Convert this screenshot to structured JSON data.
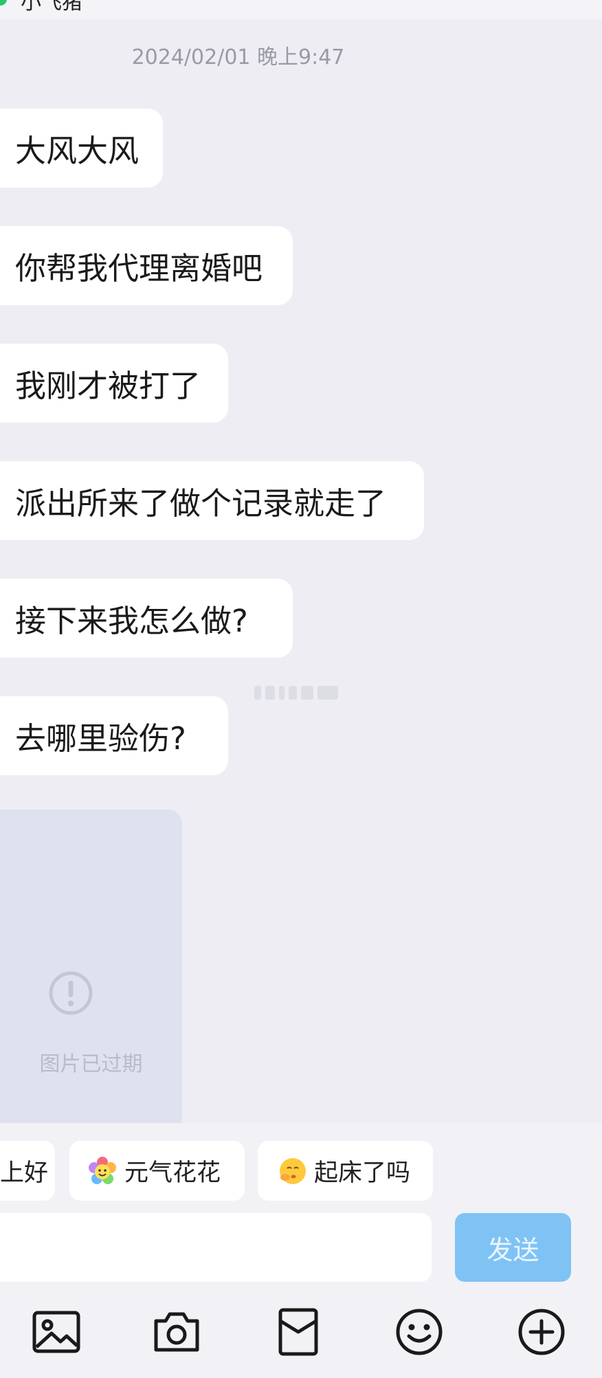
{
  "topbar": {
    "title": "小飞猪"
  },
  "chat": {
    "timestamp": "2024/02/01 晚上9:47",
    "messages": [
      {
        "text": "大风大风"
      },
      {
        "text": "你帮我代理离婚吧"
      },
      {
        "text": "我刚才被打了"
      },
      {
        "text": "派出所来了做个记录就走了"
      },
      {
        "text": "接下来我怎么做?"
      },
      {
        "text": "去哪里验伤?"
      }
    ],
    "expired_image": {
      "label": "图片已过期",
      "icon": "alert-circle-icon"
    }
  },
  "quick_replies": [
    {
      "text": "上好"
    },
    {
      "text": "元气花花",
      "icon": "flower-emoji"
    },
    {
      "text": "起床了吗",
      "icon": "shush-face-emoji"
    }
  ],
  "composer": {
    "placeholder": "",
    "send_label": "发送"
  },
  "toolbar": {
    "icons": [
      "image-icon",
      "camera-icon",
      "red-packet-icon",
      "emoji-icon",
      "plus-icon"
    ]
  },
  "colors": {
    "background": "#ededf3",
    "bubble": "#ffffff",
    "send_button": "#7fc3f5",
    "expired_tile": "#dfe1ef"
  }
}
